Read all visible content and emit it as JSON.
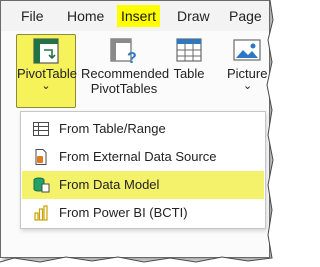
{
  "tabs": [
    {
      "label": "File"
    },
    {
      "label": "Home"
    },
    {
      "label": "Insert",
      "active": true
    },
    {
      "label": "Draw"
    },
    {
      "label": "Page"
    }
  ],
  "ribbon": {
    "pivottable": {
      "label": "PivotTable",
      "arrow": "⌄"
    },
    "recommended": {
      "line1": "Recommended",
      "line2": "PivotTables"
    },
    "table": {
      "label": "Table"
    },
    "pictures": {
      "label": "Picture",
      "arrow": "⌄"
    }
  },
  "menu": {
    "items": [
      {
        "label": "From Table/Range",
        "icon": "table-range-icon"
      },
      {
        "label": "From External Data Source",
        "icon": "external-data-icon"
      },
      {
        "label": "From Data Model",
        "icon": "data-model-icon",
        "highlighted": true
      },
      {
        "label": "From Power BI (BCTI)",
        "icon": "power-bi-icon"
      }
    ]
  },
  "colors": {
    "highlight": "#ffff00",
    "menu_highlight": "#f3f26a",
    "accent_green": "#217346"
  }
}
